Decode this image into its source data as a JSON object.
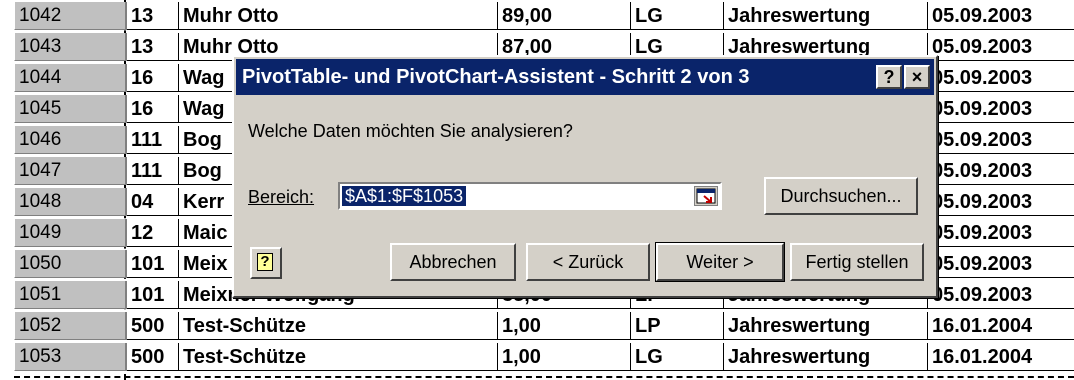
{
  "sheet": {
    "rows": [
      {
        "num": "1042",
        "c1": "13",
        "c2": "Muhr Otto",
        "c3": "89,00",
        "c4": "LG",
        "c5": "Jahreswertung",
        "c6": "05.09.2003"
      },
      {
        "num": "1043",
        "c1": "13",
        "c2": "Muhr Otto",
        "c3": "87,00",
        "c4": "LG",
        "c5": "Jahreswertung",
        "c6": "05.09.2003"
      },
      {
        "num": "1044",
        "c1": "16",
        "c2": "Wag",
        "c3": "",
        "c4": "",
        "c5": "",
        "c6": "05.09.2003"
      },
      {
        "num": "1045",
        "c1": "16",
        "c2": "Wag",
        "c3": "",
        "c4": "",
        "c5": "",
        "c6": "05.09.2003"
      },
      {
        "num": "1046",
        "c1": "111",
        "c2": "Bog",
        "c3": "",
        "c4": "",
        "c5": "",
        "c6": "05.09.2003"
      },
      {
        "num": "1047",
        "c1": "111",
        "c2": "Bog",
        "c3": "",
        "c4": "",
        "c5": "",
        "c6": "05.09.2003"
      },
      {
        "num": "1048",
        "c1": "04",
        "c2": "Kerr",
        "c3": "",
        "c4": "",
        "c5": "",
        "c6": "05.09.2003"
      },
      {
        "num": "1049",
        "c1": "12",
        "c2": "Maic",
        "c3": "",
        "c4": "",
        "c5": "",
        "c6": "05.09.2003"
      },
      {
        "num": "1050",
        "c1": "101",
        "c2": "Meix",
        "c3": "",
        "c4": "",
        "c5": "",
        "c6": "05.09.2003"
      },
      {
        "num": "1051",
        "c1": "101",
        "c2": "Meixner Wolfgang",
        "c3": "83,00",
        "c4": "LP",
        "c5": "Jahreswertung",
        "c6": "05.09.2003"
      },
      {
        "num": "1052",
        "c1": "500",
        "c2": "Test-Schütze",
        "c3": "1,00",
        "c4": "LP",
        "c5": "Jahreswertung",
        "c6": "16.01.2004"
      },
      {
        "num": "1053",
        "c1": "500",
        "c2": "Test-Schütze",
        "c3": "1,00",
        "c4": "LG",
        "c5": "Jahreswertung",
        "c6": "16.01.2004"
      }
    ]
  },
  "dialog": {
    "title": "PivotTable- und PivotChart-Assistent - Schritt 2 von 3",
    "help_title_button": "?",
    "close_button": "×",
    "question": "Welche Daten möchten Sie analysieren?",
    "range_label": "Bereich:",
    "range_value": "$A$1:$F$1053",
    "browse_button": "Durchsuchen...",
    "help_button_glyph": "?",
    "cancel_button": "Abbrechen",
    "back_button": "< Zurück",
    "next_button": "Weiter >",
    "finish_button": "Fertig stellen",
    "collapse_icon": "range-select-icon"
  }
}
